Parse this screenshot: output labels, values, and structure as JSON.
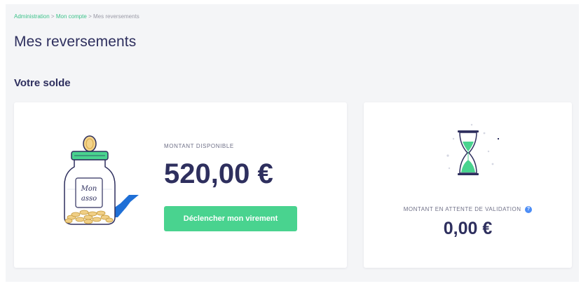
{
  "breadcrumb": {
    "items": [
      {
        "label": "Administration",
        "link": true
      },
      {
        "label": "Mon compte",
        "link": true
      },
      {
        "label": "Mes reversements",
        "link": false
      }
    ],
    "separator": ">"
  },
  "page": {
    "title": "Mes reversements"
  },
  "balance": {
    "section_title": "Votre solde",
    "available": {
      "label": "MONTANT DISPONIBLE",
      "amount": "520,00 €",
      "button_label": "Déclencher mon virement",
      "jar_label_line1": "Mon",
      "jar_label_line2": "asso"
    },
    "pending": {
      "label": "MONTANT EN ATTENTE DE VALIDATION",
      "info_glyph": "?",
      "amount": "0,00 €"
    }
  },
  "colors": {
    "accent_green": "#49d38f",
    "link_green": "#3dc28a",
    "navy": "#2e2f5e",
    "info_blue": "#4c8df6",
    "background": "#f4f5f7"
  },
  "icons": [
    "piggy-jar-illustration",
    "hourglass-illustration",
    "info-icon"
  ]
}
